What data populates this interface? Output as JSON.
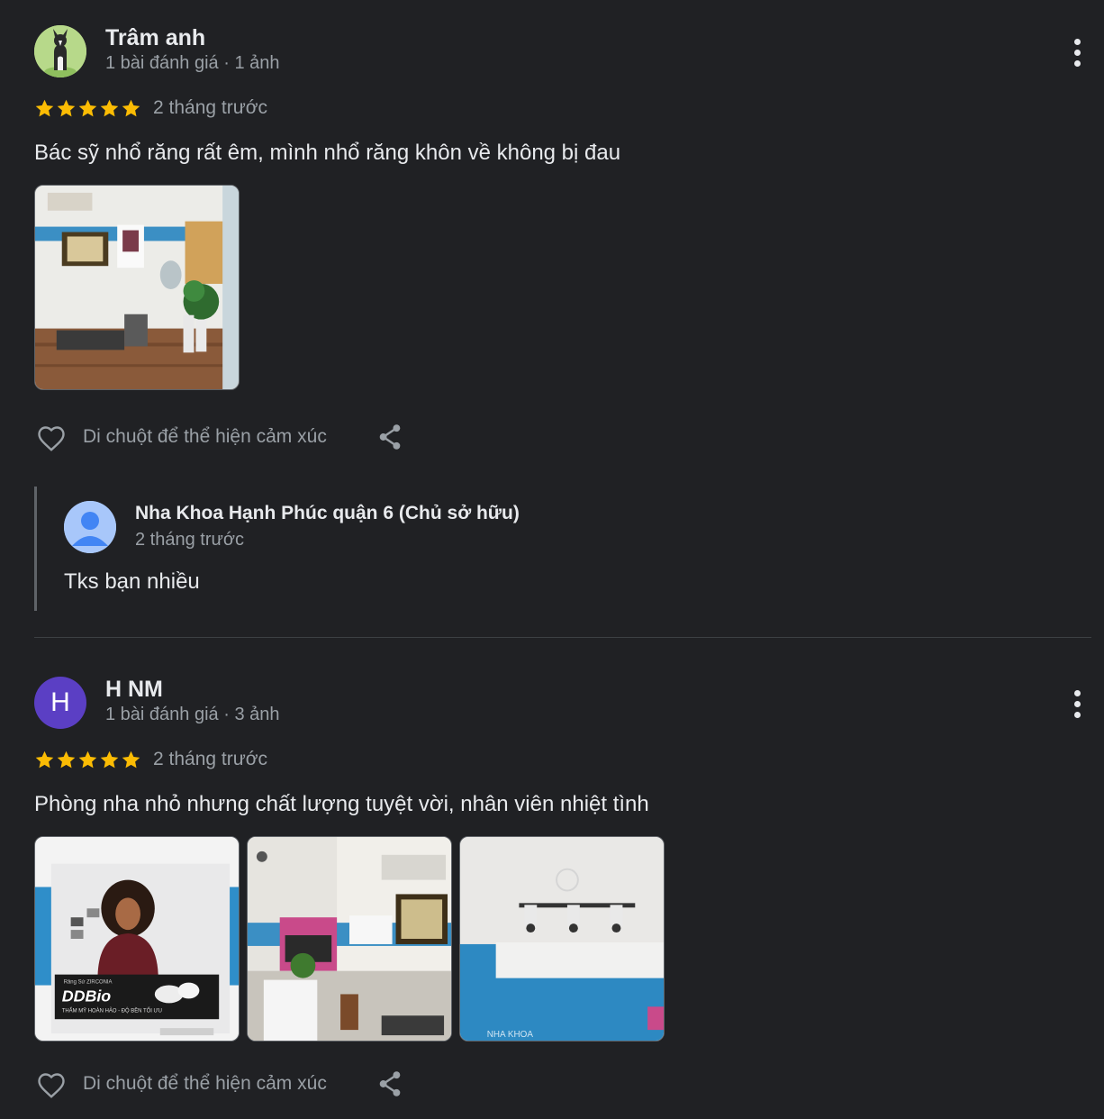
{
  "reviews": [
    {
      "author": "Trâm anh",
      "meta": "1 bài đánh giá · 1 ảnh",
      "rating": 5,
      "when": "2 tháng trước",
      "text": "Bác sỹ nhổ răng rất êm, mình nhổ răng khôn về không bị đau",
      "react_label": "Di chuột để thể hiện cảm xúc",
      "owner_reply": {
        "name": "Nha Khoa Hạnh Phúc quận 6 (Chủ sở hữu)",
        "when": "2 tháng trước",
        "text": "Tks bạn nhiều"
      }
    },
    {
      "author": "H NM",
      "avatar_letter": "H",
      "meta": "1 bài đánh giá · 3 ảnh",
      "rating": 5,
      "when": "2 tháng trước",
      "text": "Phòng nha nhỏ nhưng chất lượng tuyệt vời, nhân viên nhiệt tình",
      "react_label": "Di chuột để thể hiện cảm xúc",
      "photo_text": {
        "brand": "DDBio",
        "brand_top": "Răng Sứ ZIRCONIA",
        "brand_sub": "THẨM MỸ HOÀN HẢO - ĐỘ BỀN TỐI ƯU"
      }
    }
  ],
  "colors": {
    "background": "#202124",
    "star": "#fbbc04",
    "secondary_text": "#9aa0a6",
    "letter_avatar": "#5b3fc4"
  }
}
